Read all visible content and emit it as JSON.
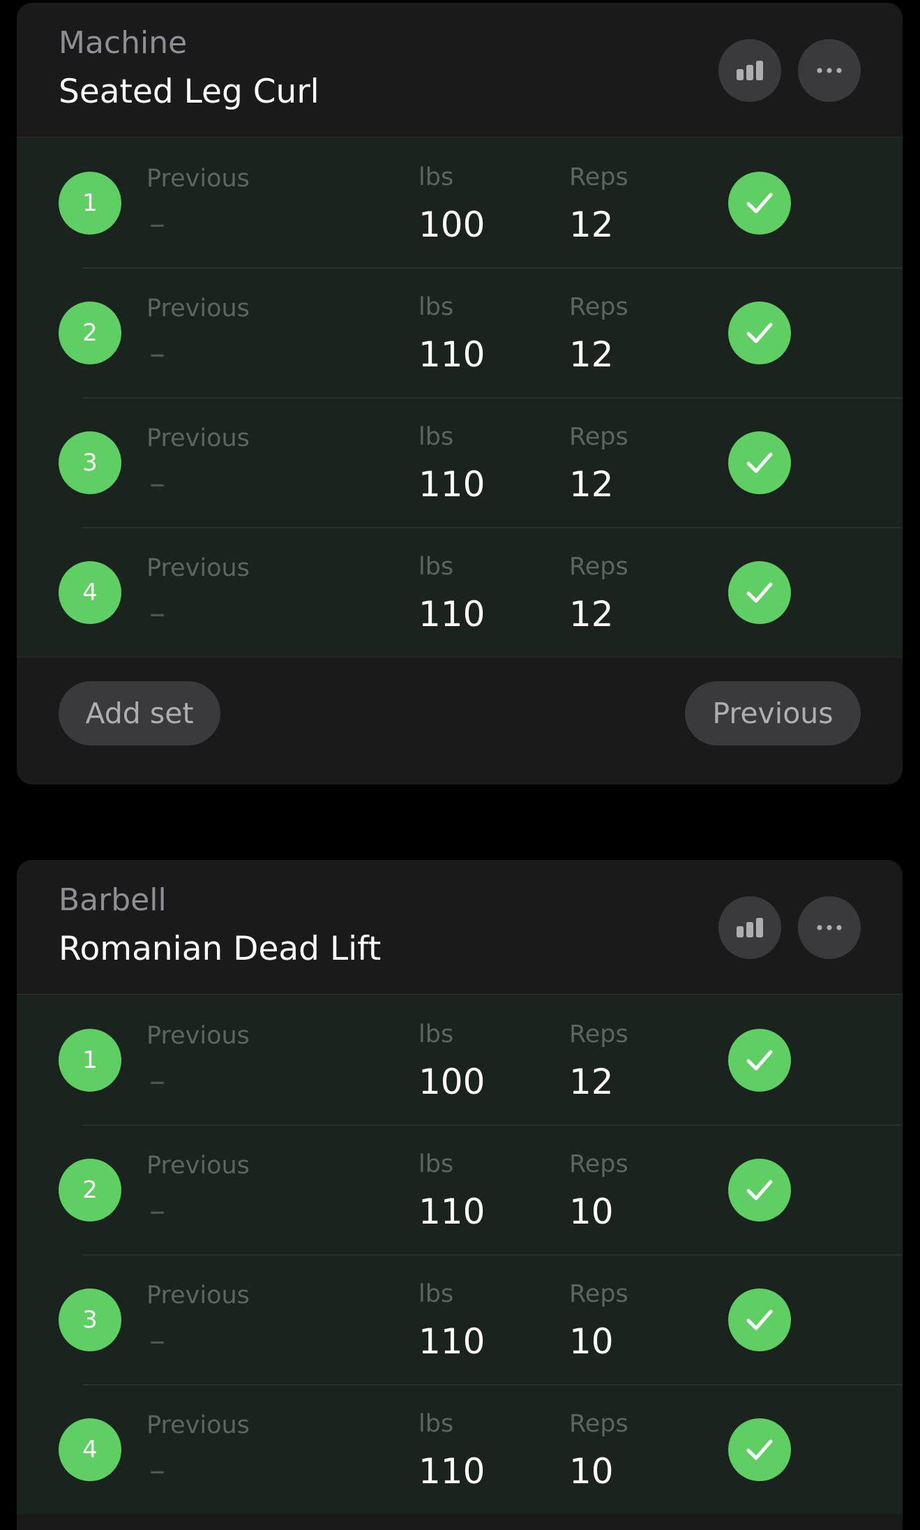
{
  "colors": {
    "background": "#000000",
    "card": "#1a1a1b",
    "completed_row": "#1b231f",
    "accent_green": "#5fcf63",
    "button": "#3a3a3c"
  },
  "labels": {
    "previous": "Previous",
    "lbs": "lbs",
    "reps": "Reps",
    "previous_empty": "–",
    "add_set": "Add set",
    "previous_button": "Previous"
  },
  "icons": {
    "stats": "bar-chart-icon",
    "more": "ellipsis-icon",
    "done": "checkmark-icon"
  },
  "exercises": [
    {
      "category": "Machine",
      "name": "Seated Leg Curl",
      "sets": [
        {
          "number": "1",
          "previous": "–",
          "lbs": "100",
          "reps": "12",
          "completed": true
        },
        {
          "number": "2",
          "previous": "–",
          "lbs": "110",
          "reps": "12",
          "completed": true
        },
        {
          "number": "3",
          "previous": "–",
          "lbs": "110",
          "reps": "12",
          "completed": true
        },
        {
          "number": "4",
          "previous": "–",
          "lbs": "110",
          "reps": "12",
          "completed": true
        }
      ]
    },
    {
      "category": "Barbell",
      "name": "Romanian Dead Lift",
      "sets": [
        {
          "number": "1",
          "previous": "–",
          "lbs": "100",
          "reps": "12",
          "completed": true
        },
        {
          "number": "2",
          "previous": "–",
          "lbs": "110",
          "reps": "10",
          "completed": true
        },
        {
          "number": "3",
          "previous": "–",
          "lbs": "110",
          "reps": "10",
          "completed": true
        },
        {
          "number": "4",
          "previous": "–",
          "lbs": "110",
          "reps": "10",
          "completed": true
        }
      ]
    }
  ]
}
